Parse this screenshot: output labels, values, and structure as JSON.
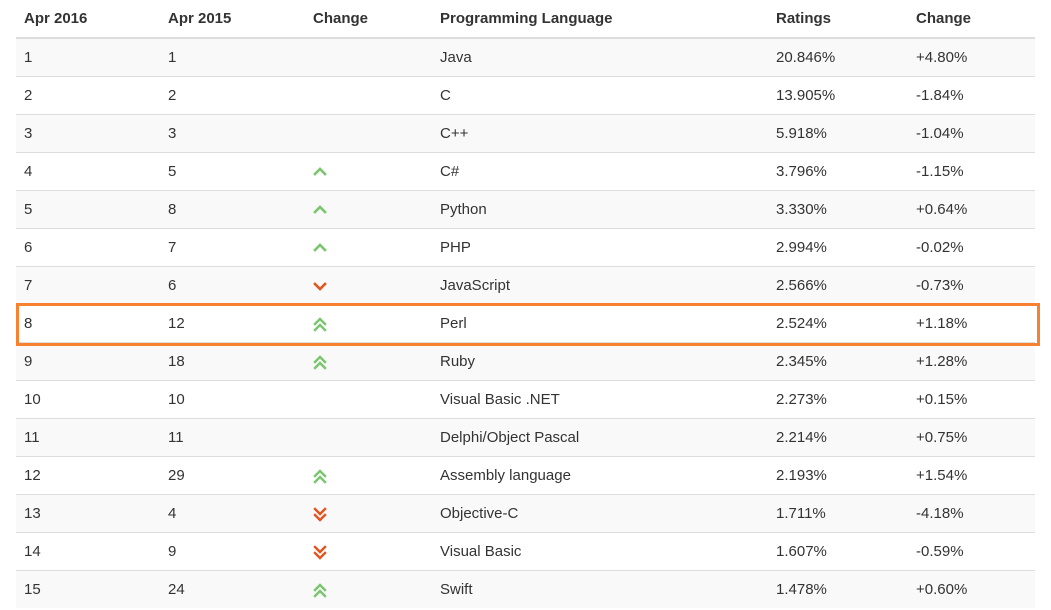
{
  "colors": {
    "up": "#7ac56e",
    "down": "#e3541e",
    "highlight_border": "#f7812f"
  },
  "headers": [
    "Apr 2016",
    "Apr 2015",
    "Change",
    "Programming Language",
    "Ratings",
    "Change"
  ],
  "rows": [
    {
      "rank_2016": "1",
      "rank_2015": "1",
      "trend": "none",
      "language": "Java",
      "rating": "20.846%",
      "change": "+4.80%"
    },
    {
      "rank_2016": "2",
      "rank_2015": "2",
      "trend": "none",
      "language": "C",
      "rating": "13.905%",
      "change": "-1.84%"
    },
    {
      "rank_2016": "3",
      "rank_2015": "3",
      "trend": "none",
      "language": "C++",
      "rating": "5.918%",
      "change": "-1.04%"
    },
    {
      "rank_2016": "4",
      "rank_2015": "5",
      "trend": "up",
      "language": "C#",
      "rating": "3.796%",
      "change": "-1.15%"
    },
    {
      "rank_2016": "5",
      "rank_2015": "8",
      "trend": "up",
      "language": "Python",
      "rating": "3.330%",
      "change": "+0.64%"
    },
    {
      "rank_2016": "6",
      "rank_2015": "7",
      "trend": "up",
      "language": "PHP",
      "rating": "2.994%",
      "change": "-0.02%"
    },
    {
      "rank_2016": "7",
      "rank_2015": "6",
      "trend": "down",
      "language": "JavaScript",
      "rating": "2.566%",
      "change": "-0.73%"
    },
    {
      "rank_2016": "8",
      "rank_2015": "12",
      "trend": "double-up",
      "language": "Perl",
      "rating": "2.524%",
      "change": "+1.18%",
      "highlighted": true
    },
    {
      "rank_2016": "9",
      "rank_2015": "18",
      "trend": "double-up",
      "language": "Ruby",
      "rating": "2.345%",
      "change": "+1.28%"
    },
    {
      "rank_2016": "10",
      "rank_2015": "10",
      "trend": "none",
      "language": "Visual Basic .NET",
      "rating": "2.273%",
      "change": "+0.15%"
    },
    {
      "rank_2016": "11",
      "rank_2015": "11",
      "trend": "none",
      "language": "Delphi/Object Pascal",
      "rating": "2.214%",
      "change": "+0.75%"
    },
    {
      "rank_2016": "12",
      "rank_2015": "29",
      "trend": "double-up",
      "language": "Assembly language",
      "rating": "2.193%",
      "change": "+1.54%"
    },
    {
      "rank_2016": "13",
      "rank_2015": "4",
      "trend": "double-down",
      "language": "Objective-C",
      "rating": "1.711%",
      "change": "-4.18%"
    },
    {
      "rank_2016": "14",
      "rank_2015": "9",
      "trend": "double-down",
      "language": "Visual Basic",
      "rating": "1.607%",
      "change": "-0.59%"
    },
    {
      "rank_2016": "15",
      "rank_2015": "24",
      "trend": "double-up",
      "language": "Swift",
      "rating": "1.478%",
      "change": "+0.60%"
    }
  ]
}
